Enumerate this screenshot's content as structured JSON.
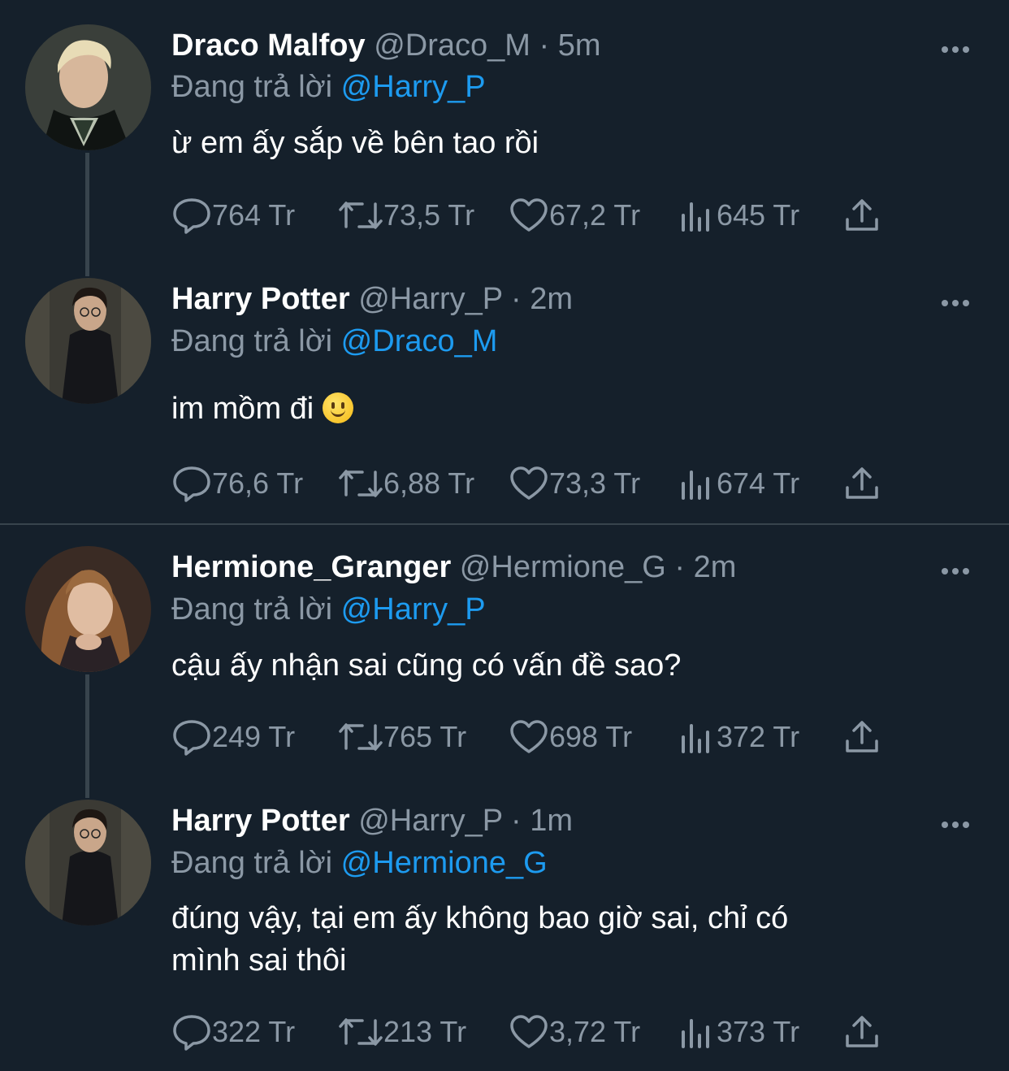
{
  "tweets": [
    {
      "name": "Draco Malfoy",
      "handle": "@Draco_M",
      "dot": "·",
      "time": "5m",
      "reply_prefix": "Đang trả lời",
      "reply_to": "@Harry_P",
      "text": "ừ em ấy sắp về bên tao rồi",
      "replies": "764 Tr",
      "retweets": "73,5 Tr",
      "likes": "67,2 Tr",
      "views": "645 Tr"
    },
    {
      "name": "Harry Potter",
      "handle": "@Harry_P",
      "dot": "·",
      "time": "2m",
      "reply_prefix": "Đang trả lời",
      "reply_to": "@Draco_M",
      "text": "im mồm đi",
      "replies": "76,6 Tr",
      "retweets": "6,88 Tr",
      "likes": "73,3 Tr",
      "views": "674 Tr"
    },
    {
      "name": "Hermione_Granger",
      "handle": "@Hermione_G",
      "dot": "·",
      "time": "2m",
      "reply_prefix": "Đang trả lời",
      "reply_to": "@Harry_P",
      "text": "cậu ấy nhận sai cũng có vấn đề sao?",
      "replies": "249 Tr",
      "retweets": "765 Tr",
      "likes": "698 Tr",
      "views": "372 Tr"
    },
    {
      "name": "Harry Potter",
      "handle": "@Harry_P",
      "dot": "·",
      "time": "1m",
      "reply_prefix": "Đang trả lời",
      "reply_to": "@Hermione_G",
      "text_line1": "đúng vậy, tại em ấy không bao giờ sai, chỉ có",
      "text_line2": "mình sai thôi",
      "replies": "322 Tr",
      "retweets": "213 Tr",
      "likes": "3,72 Tr",
      "views": "373 Tr"
    }
  ],
  "colors": {
    "background": "#15202b",
    "text": "#ffffff",
    "muted": "#8b98a5",
    "mention": "#1d9bf0",
    "divider": "#38444d"
  },
  "icons": [
    "reply-icon",
    "retweet-icon",
    "like-icon",
    "views-icon",
    "share-icon",
    "more-icon"
  ]
}
